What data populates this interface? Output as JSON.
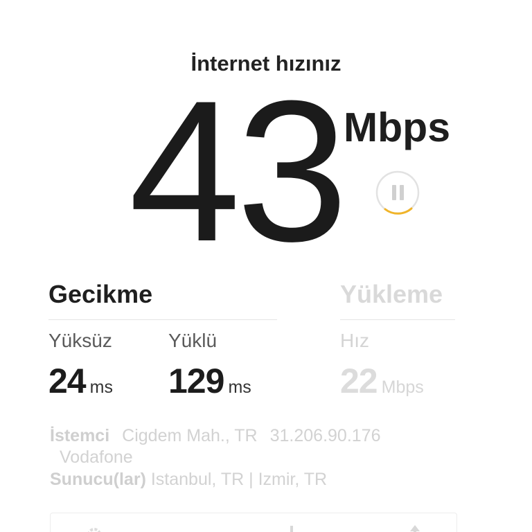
{
  "header": {
    "title": "İnternet hızınız"
  },
  "result": {
    "speed_value": "43",
    "speed_unit": "Mbps"
  },
  "latency": {
    "heading": "Gecikme",
    "unloaded_label": "Yüksüz",
    "unloaded_value": "24",
    "unloaded_unit": "ms",
    "loaded_label": "Yüklü",
    "loaded_value": "129",
    "loaded_unit": "ms"
  },
  "upload": {
    "heading": "Yükleme",
    "speed_label": "Hız",
    "speed_value": "22",
    "speed_unit": "Mbps"
  },
  "client": {
    "label": "İstemci",
    "location": "Cigdem Mah., TR",
    "ip": "31.206.90.176",
    "isp": "Vodafone"
  },
  "server": {
    "label": "Sunucu(lar)",
    "locations": "Istanbul, TR  |  Izmir, TR"
  },
  "colors": {
    "accent": "#f0b429",
    "text_dark": "#1e1e1e",
    "text_faded": "#d2d2d2"
  },
  "icons": {
    "pause": "pause-icon",
    "settings": "gear-icon",
    "download": "arrow-down-icon",
    "upload": "arrow-up-icon"
  }
}
